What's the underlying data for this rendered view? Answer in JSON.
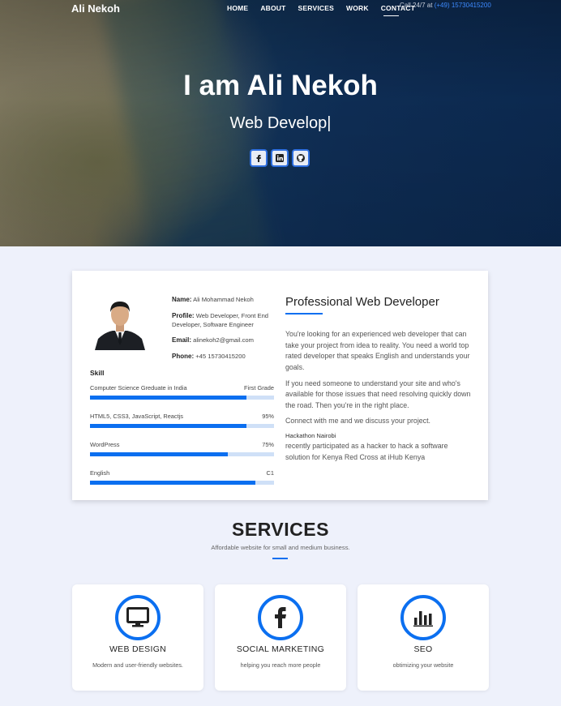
{
  "nav": {
    "brand": "Ali Nekoh",
    "items": [
      {
        "label": "HOME"
      },
      {
        "label": "ABOUT"
      },
      {
        "label": "SERVICES"
      },
      {
        "label": "WORK"
      },
      {
        "label": "CONTACT"
      }
    ],
    "call_prefix": "Call 24/7 at",
    "call_phone": "(+49) 15730415200"
  },
  "hero": {
    "title": "I am Ali Nekoh",
    "typed_subtitle": "Web Develop|",
    "socials": [
      {
        "icon": "facebook-icon"
      },
      {
        "icon": "linkedin-icon"
      },
      {
        "icon": "github-icon"
      }
    ]
  },
  "about": {
    "name_label": "Name:",
    "name_value": "Ali Mohammad Nekoh",
    "profile_label": "Profile:",
    "profile_value": "Web Developer, Front End Developer, Software Engineer",
    "email_label": "Email:",
    "email_value": "alinekoh2@gmail.com",
    "phone_label": "Phone:",
    "phone_value": "+45 15730415200",
    "skill_heading": "Skill",
    "skills": [
      {
        "label": "Computer Science Greduate in India",
        "value": "First Grade",
        "level": 0.85
      },
      {
        "label": "HTML5, CSS3, JavaScript, Reactjs",
        "value": "95%",
        "level": 0.85
      },
      {
        "label": "WordPress",
        "value": "75%",
        "level": 0.75
      },
      {
        "label": "English",
        "value": "C1",
        "level": 0.9
      }
    ],
    "heading": "Professional Web Developer",
    "para1": "You're looking for an experienced web developer that can take your project from idea to reality. You need a world top rated developer that speaks English and understands your goals.",
    "para2": "If you need someone to understand your site and who's available for those issues that need resolving quickly down the road. Then you're in the right place.",
    "para3": "Connect with me and we discuss your project.",
    "hack_title": "Hackathon Nairobi",
    "hack_text": "recently participated as a hacker to hack a software solution for Kenya Red Cross at iHub Kenya"
  },
  "services": {
    "title": "SERVICES",
    "subtitle": "Affordable website for small and medium business.",
    "cards": [
      {
        "icon": "monitor-icon",
        "name": "WEB DESIGN",
        "desc": "Modern and user-friendly websites."
      },
      {
        "icon": "facebook-icon",
        "name": "SOCIAL MARKETING",
        "desc": "helping you reach more people"
      },
      {
        "icon": "bar-chart-icon",
        "name": "SEO",
        "desc": "obtimizing your website"
      }
    ]
  },
  "colors": {
    "accent": "#0b6ff0",
    "page_bg": "#eef1fb",
    "hero_text": "#ffffff"
  }
}
